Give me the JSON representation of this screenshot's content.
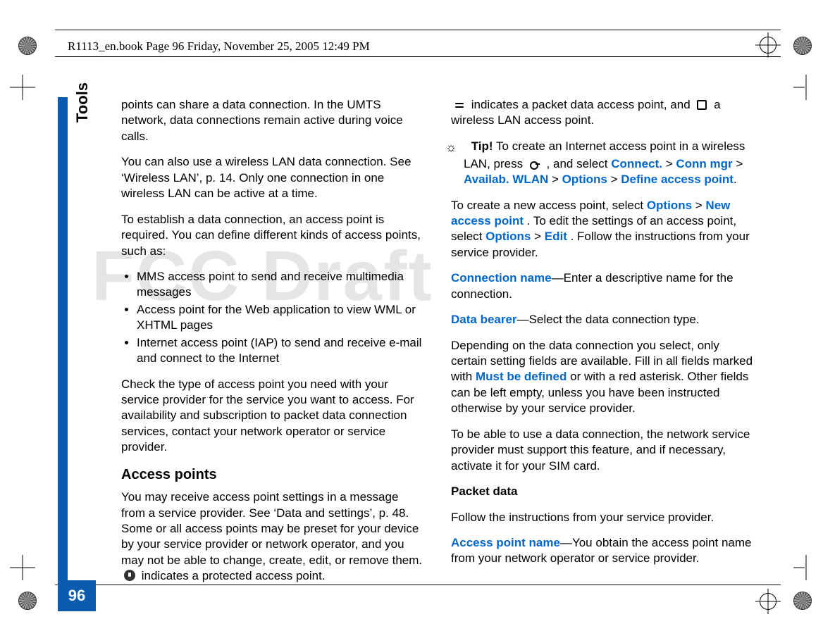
{
  "header": {
    "book_line": "R1113_en.book  Page 96  Friday, November 25, 2005  12:49 PM"
  },
  "side": {
    "section_label": "Tools",
    "page_number": "96"
  },
  "watermark": "FCC Draft",
  "col1": {
    "p1": "points can share a data connection. In the UMTS network, data connections remain active during voice calls.",
    "p2": "You can also use a wireless LAN data connection. See ‘Wireless LAN’, p. 14. Only one connection in one wireless LAN can be active at a time.",
    "p3": "To establish a data connection, an access point is required. You can define different kinds of access points, such as:",
    "bullets": [
      "MMS access point to send and receive multimedia messages",
      "Access point for the Web application to view WML or XHTML pages",
      "Internet access point (IAP) to send and receive e-mail and connect to the Internet"
    ],
    "p4": "Check the type of access point you need with your service provider for the service you want to access. For availability and subscription to packet data connection services, contact your network operator or service provider.",
    "h3": "Access points",
    "p5a": "You may receive access point settings in a message from a service provider. See ‘Data and settings’, p. 48. Some or all access points may be preset for your device by your service provider or network operator, and you may not be able to change, create, edit, or remove them. ",
    "p5b": " indicates a protected access point."
  },
  "col2": {
    "p1a": " indicates a packet data access point, and ",
    "p1b": " a wireless LAN access point.",
    "tip_label": "Tip!",
    "tip_body_a": " To create an Internet access point in a wireless LAN, press ",
    "tip_body_b": " , and select ",
    "tip_link1": "Connect.",
    "tip_gt": " > ",
    "tip_link2": "Conn mgr",
    "tip_link3": "Availab. WLAN",
    "tip_link4": "Options",
    "tip_link5": "Define access point",
    "p2a": "To create a new access point, select ",
    "p2_link_options": "Options",
    "p2_link_new": "New access point",
    "p2b": ". To edit the settings of an access point, select ",
    "p2_link_edit": "Edit",
    "p2c": ". Follow the instructions from your service provider.",
    "p3_label": "Connection name",
    "p3_body": "—Enter a descriptive name for the connection.",
    "p4_label": "Data bearer",
    "p4_body": "—Select the data connection type.",
    "p5a": "Depending on the data connection you select, only certain setting fields are available. Fill in all fields marked with ",
    "p5_link": "Must be defined",
    "p5b": " or with a red asterisk. Other fields can be left empty, unless you have been instructed otherwise by your service provider.",
    "p6": "To be able to use a data connection, the network service provider must support this feature, and if necessary, activate it for your SIM card.",
    "h_pd": "Packet data",
    "p7": "Follow the instructions from your service provider.",
    "p8_label": "Access point name",
    "p8_body": "—You obtain the access point name from your network operator or service provider."
  }
}
